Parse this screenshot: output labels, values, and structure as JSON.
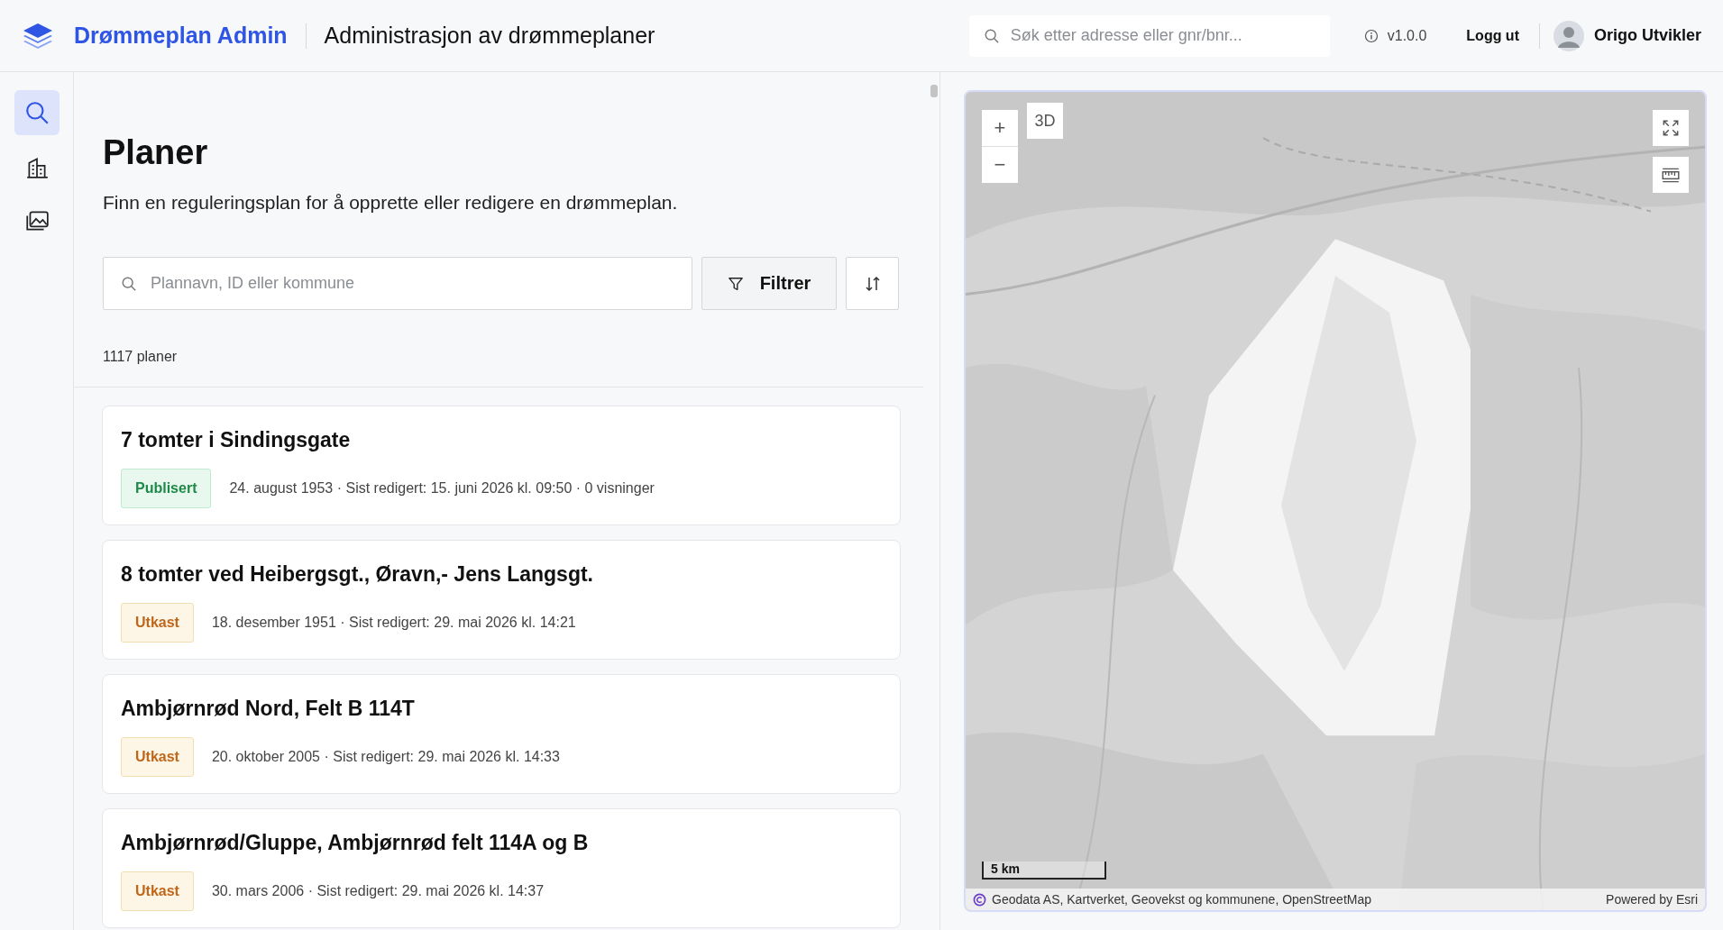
{
  "header": {
    "app_name": "Drømmeplan Admin",
    "subtitle": "Administrasjon av drømmeplaner",
    "search": {
      "placeholder": "Søk etter adresse eller gnr/bnr..."
    },
    "version": "v1.0.0",
    "logout": "Logg ut",
    "user": "Origo Utvikler"
  },
  "sidebar": {
    "items": [
      {
        "kind": "search",
        "selected": true
      },
      {
        "kind": "buildings",
        "selected": false
      },
      {
        "kind": "images",
        "selected": false
      }
    ]
  },
  "page": {
    "title": "Planer",
    "description": "Finn en reguleringsplan for å opprette eller redigere en drømmeplan.",
    "search": {
      "placeholder": "Plannavn, ID eller kommune"
    },
    "filter_button": "Filtrer",
    "count": "1117 planer"
  },
  "plans": [
    {
      "title": "7 tomter i Sindingsgate",
      "status": {
        "kind": "published",
        "label": "Publisert"
      },
      "meta": "24. august 1953 · Sist redigert: 15. juni 2026 kl. 09:50 · 0 visninger"
    },
    {
      "title": "8 tomter ved Heibergsgt., Øravn,- Jens Langsgt.",
      "status": {
        "kind": "draft",
        "label": "Utkast"
      },
      "meta": "18. desember 1951 · Sist redigert: 29. mai 2026 kl. 14:21"
    },
    {
      "title": "Ambjørnrød Nord, Felt B 114T",
      "status": {
        "kind": "draft",
        "label": "Utkast"
      },
      "meta": "20. oktober 2005 · Sist redigert: 29. mai 2026 kl. 14:33"
    },
    {
      "title": "Ambjørnrød/Gluppe, Ambjørnrød felt 114A og B",
      "status": {
        "kind": "draft",
        "label": "Utkast"
      },
      "meta": "30. mars 2006 · Sist redigert: 29. mai 2026 kl. 14:37"
    }
  ],
  "map": {
    "zoom_in": "+",
    "zoom_out": "−",
    "view_3d": "3D",
    "scale": "5 km",
    "attribution": "Geodata AS, Kartverket, Geovekst og kommunene, OpenStreetMap",
    "powered_by": "Powered by Esri"
  }
}
